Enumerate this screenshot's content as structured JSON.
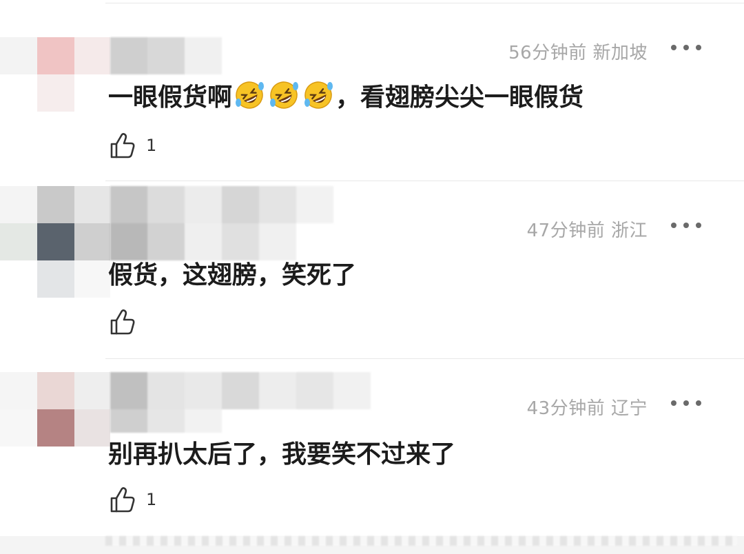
{
  "comments": [
    {
      "time": "56分钟前",
      "location": "新加坡",
      "text": "一眼假货啊",
      "emoji": [
        "🤣",
        "🤣",
        "🤣"
      ],
      "text_after": "，看翅膀尖尖一眼假货",
      "like_count": "1",
      "more_icon": "more-icon"
    },
    {
      "time": "47分钟前",
      "location": "浙江",
      "text": "假货，这翅膀，笑死了",
      "like_count": "",
      "more_icon": "more-icon"
    },
    {
      "time": "43分钟前",
      "location": "辽宁",
      "text": "别再扒太后了，我要笑不过来了",
      "like_count": "1",
      "more_icon": "more-icon"
    }
  ],
  "icons": {
    "like": "thumbs-up-icon",
    "emoji": "rolling-on-floor-laughing-icon"
  },
  "colors": {
    "meta_text": "#a7a7a7",
    "body_text": "#1c1c1c",
    "divider": "#e8e8e8",
    "emoji_face": "#f7c325"
  }
}
